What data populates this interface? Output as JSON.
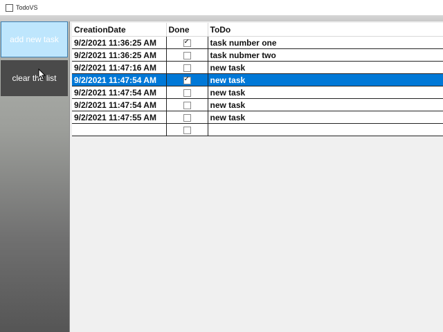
{
  "window": {
    "title": "TodoVS"
  },
  "sidebar": {
    "add_label": "add new task",
    "clear_label": "clear the list"
  },
  "grid": {
    "columns": [
      "CreationDate",
      "Done",
      "ToDo"
    ],
    "rows": [
      {
        "date": "9/2/2021 11:36:25 AM",
        "done": true,
        "todo": "task number one",
        "selected": false
      },
      {
        "date": "9/2/2021 11:36:25 AM",
        "done": false,
        "todo": "task nubmer two",
        "selected": false
      },
      {
        "date": "9/2/2021 11:47:16 AM",
        "done": false,
        "todo": "new task",
        "selected": false
      },
      {
        "date": "9/2/2021 11:47:54 AM",
        "done": true,
        "todo": "new task",
        "selected": true
      },
      {
        "date": "9/2/2021 11:47:54 AM",
        "done": false,
        "todo": "new task",
        "selected": false
      },
      {
        "date": "9/2/2021 11:47:54 AM",
        "done": false,
        "todo": "new task",
        "selected": false
      },
      {
        "date": "9/2/2021 11:47:55 AM",
        "done": false,
        "todo": "new task",
        "selected": false
      },
      {
        "date": "",
        "done": false,
        "todo": "",
        "selected": false
      }
    ]
  },
  "colors": {
    "selection": "#0078d7",
    "button_hover": "#bee6fd",
    "button_dark": "#4a4a4a"
  }
}
